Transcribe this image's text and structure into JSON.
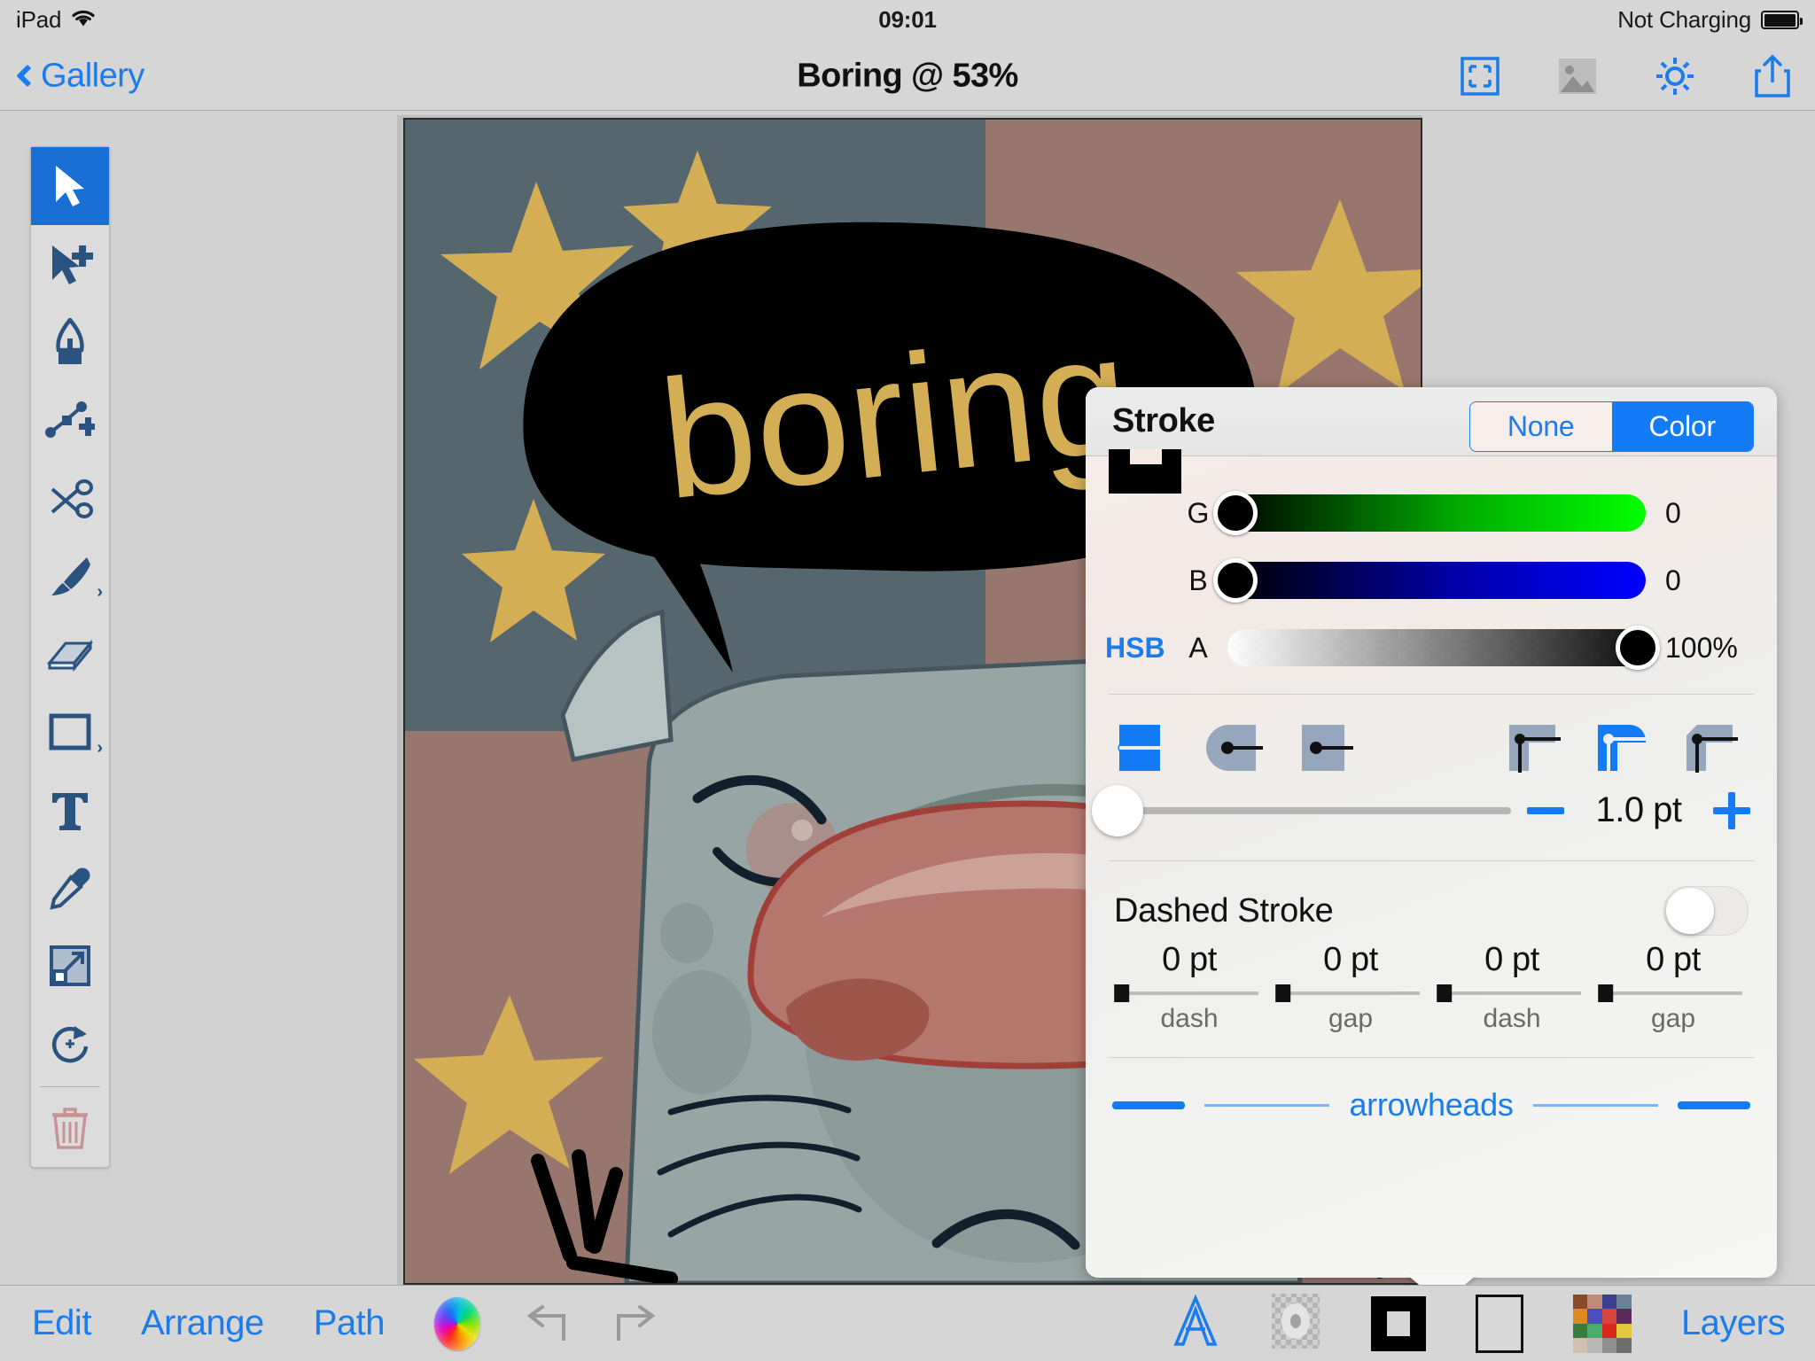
{
  "status_bar": {
    "device": "iPad",
    "wifi_icon": "wifi-icon",
    "time": "09:01",
    "battery_text": "Not Charging",
    "battery_icon": "battery-full-icon"
  },
  "nav_bar": {
    "back_label": "Gallery",
    "back_icon": "chevron-left-icon",
    "title": "Boring @ 53%",
    "actions": [
      {
        "name": "fit-to-screen-icon",
        "label": "Fit to screen"
      },
      {
        "name": "image-icon",
        "label": "Image"
      },
      {
        "name": "gear-icon",
        "label": "Settings"
      },
      {
        "name": "share-icon",
        "label": "Share"
      }
    ]
  },
  "tools": [
    {
      "name": "select-tool",
      "label": "Select",
      "selected": true
    },
    {
      "name": "add-select-tool",
      "label": "Add to selection",
      "selected": false
    },
    {
      "name": "pen-tool",
      "label": "Pen",
      "selected": false
    },
    {
      "name": "add-node-tool",
      "label": "Add node",
      "selected": false
    },
    {
      "name": "scissors-tool",
      "label": "Scissors",
      "selected": false
    },
    {
      "name": "brush-tool",
      "label": "Brush",
      "selected": false,
      "has_chevron": true
    },
    {
      "name": "eraser-tool",
      "label": "Eraser",
      "selected": false
    },
    {
      "name": "rectangle-tool",
      "label": "Rectangle",
      "selected": false,
      "has_chevron": true
    },
    {
      "name": "text-tool",
      "label": "Text",
      "selected": false
    },
    {
      "name": "eyedropper-tool",
      "label": "Eyedropper",
      "selected": false
    },
    {
      "name": "scale-tool",
      "label": "Scale",
      "selected": false
    },
    {
      "name": "rotate-tool",
      "label": "Rotate",
      "selected": false
    },
    {
      "name": "delete-tool",
      "label": "Delete",
      "selected": false
    }
  ],
  "artwork": {
    "speech_text": "boring",
    "colors": {
      "bg_blue": "#56666f",
      "bg_rose": "#97766e",
      "star_gold": "#d4ae55",
      "bubble": "#000000",
      "face": "#97a6a4",
      "nose": "#b5776d"
    }
  },
  "stroke_panel": {
    "title": "Stroke",
    "segments": [
      {
        "label": "None",
        "selected": false
      },
      {
        "label": "Color",
        "selected": true
      }
    ],
    "color_mode_link": "HSB",
    "sliders": [
      {
        "label": "G",
        "value": "0",
        "fill": 0
      },
      {
        "label": "B",
        "value": "0",
        "fill": 0
      },
      {
        "label": "A",
        "value": "100%",
        "fill": 100
      }
    ],
    "cap_styles": [
      {
        "name": "cap-butt-icon",
        "selected": true
      },
      {
        "name": "cap-round-icon",
        "selected": false
      },
      {
        "name": "cap-square-icon",
        "selected": false
      }
    ],
    "join_styles": [
      {
        "name": "join-miter-icon",
        "selected": false
      },
      {
        "name": "join-round-icon",
        "selected": true
      },
      {
        "name": "join-bevel-icon",
        "selected": false
      }
    ],
    "width": {
      "value": "1.0 pt",
      "minus_label": "minus-icon",
      "plus_label": "plus-icon",
      "slider_pct": 2
    },
    "dashed": {
      "title": "Dashed Stroke",
      "enabled": false,
      "fields": [
        {
          "value": "0 pt",
          "caption": "dash"
        },
        {
          "value": "0 pt",
          "caption": "gap"
        },
        {
          "value": "0 pt",
          "caption": "dash"
        },
        {
          "value": "0 pt",
          "caption": "gap"
        }
      ]
    },
    "arrowheads_label": "arrowheads"
  },
  "bottom_bar": {
    "links": [
      "Edit",
      "Arrange",
      "Path"
    ],
    "color_wheel_icon": "color-wheel-icon",
    "undo_icon": "undo-icon",
    "redo_icon": "redo-icon",
    "text_icon": "text-style-icon",
    "gradient_icon": "gradient-icon",
    "stroke_swatch": "stroke-swatch",
    "fill_swatch": "fill-swatch",
    "palette_icon": "palette-icon",
    "layers_label": "Layers",
    "palette_colors": [
      "#8a4a2a",
      "#c08a78",
      "#3a3f8f",
      "#6b8296",
      "#e08a1e",
      "#4a4fc0",
      "#d9453f",
      "#5a2a5a",
      "#3a7a3a",
      "#4aab6a",
      "#d9281e",
      "#e0c83a",
      "#cfc0b0",
      "#b8b8b8",
      "#8f8f8f",
      "#6e6e6e"
    ]
  }
}
